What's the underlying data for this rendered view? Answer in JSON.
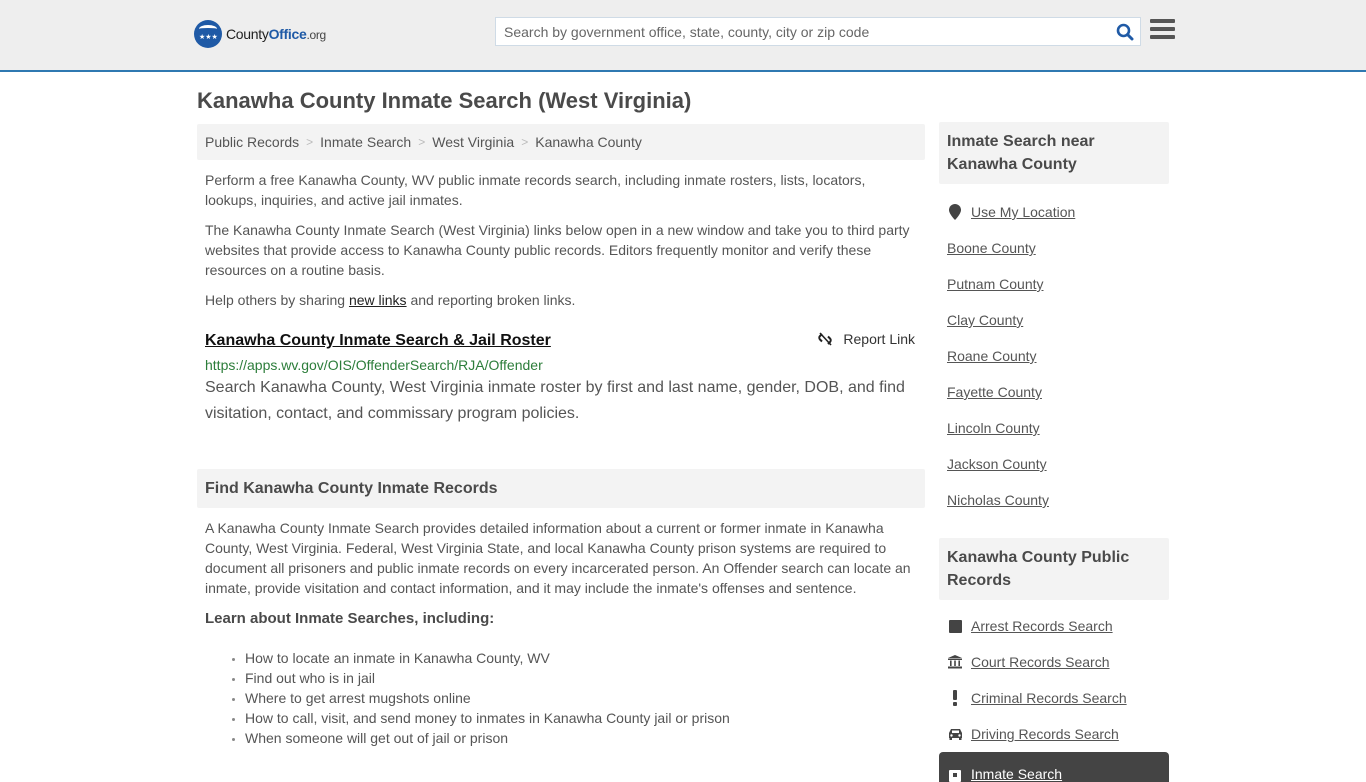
{
  "header": {
    "logo": {
      "part1": "County",
      "part2": "Office",
      "part3": ".org"
    },
    "search_placeholder": "Search by government office, state, county, city or zip code",
    "search_icon": "search-icon",
    "menu_icon": "hamburger-menu-icon",
    "accent_color": "#2f79b1"
  },
  "page_title": "Kanawha County Inmate Search (West Virginia)",
  "breadcrumb": [
    "Public Records",
    "Inmate Search",
    "West Virginia",
    "Kanawha County"
  ],
  "breadcrumb_sep": ">",
  "intro": {
    "p1": "Perform a free Kanawha County, WV public inmate records search, including inmate rosters, lists, locators, lookups, inquiries, and active jail inmates.",
    "p2": "The Kanawha County Inmate Search (West Virginia) links below open in a new window and take you to third party websites that provide access to Kanawha County public records. Editors frequently monitor and verify these resources on a routine basis.",
    "p3_before": "Help others by sharing ",
    "p3_link": "new links",
    "p3_after": " and reporting broken links."
  },
  "links": [
    {
      "title": "Kanawha County Inmate Search & Jail Roster",
      "url": "https://apps.wv.gov/OIS/OffenderSearch/RJA/Offender",
      "description": "Search Kanawha County, West Virginia inmate roster by first and last name, gender, DOB, and find visitation, contact, and commissary program policies.",
      "report_label": "Report Link",
      "report_icon": "broken-link-icon"
    }
  ],
  "find_section": {
    "heading": "Find Kanawha County Inmate Records",
    "body": "A Kanawha County Inmate Search provides detailed information about a current or former inmate in Kanawha County, West Virginia. Federal, West Virginia State, and local Kanawha County prison systems are required to document all prisoners and public inmate records on every incarcerated person. An Offender search can locate an inmate, provide visitation and contact information, and it may include the inmate's offenses and sentence.",
    "learn_heading": "Learn about Inmate Searches, including:",
    "topics": [
      "How to locate an inmate in Kanawha County, WV",
      "Find out who is in jail",
      "Where to get arrest mugshots online",
      "How to call, visit, and send money to inmates in Kanawha County jail or prison",
      "When someone will get out of jail or prison"
    ]
  },
  "sidebar": {
    "nearby_heading": "Inmate Search near Kanawha County",
    "use_location": {
      "label": "Use My Location",
      "icon": "map-pin-icon"
    },
    "nearby": [
      "Boone County",
      "Putnam County",
      "Clay County",
      "Roane County",
      "Fayette County",
      "Lincoln County",
      "Jackson County",
      "Nicholas County"
    ],
    "records_heading": "Kanawha County Public Records",
    "records": [
      {
        "label": "Arrest Records Search",
        "icon": "square-icon"
      },
      {
        "label": "Court Records Search",
        "icon": "courthouse-icon"
      },
      {
        "label": "Criminal Records Search",
        "icon": "exclamation-icon"
      },
      {
        "label": "Driving Records Search",
        "icon": "car-icon"
      },
      {
        "label": "Inmate Search",
        "icon": "id-card-icon",
        "active": true
      }
    ]
  }
}
